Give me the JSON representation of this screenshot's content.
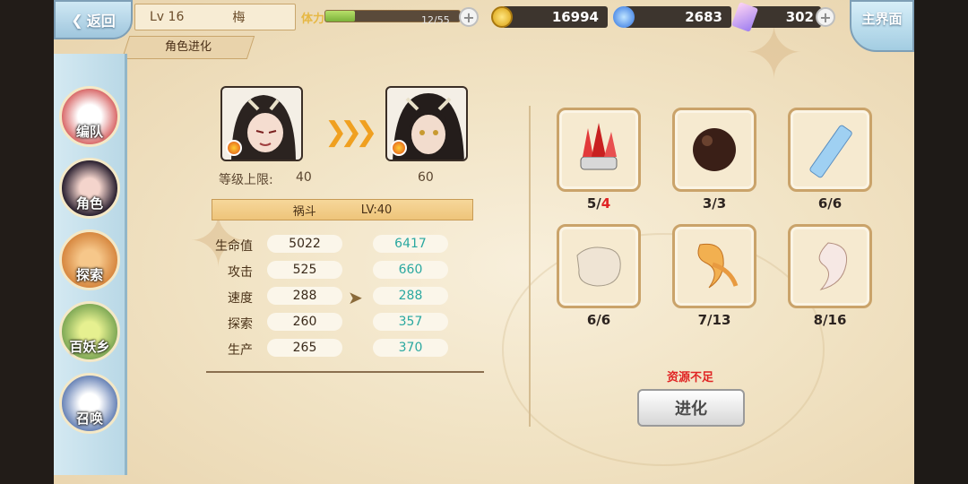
{
  "topbar": {
    "back_label": "返回",
    "level": "Lv 16",
    "name": "梅",
    "stamina_label": "体力",
    "stamina_value": "12/55",
    "stamina_fraction": 0.22,
    "gold": "16994",
    "soul": "2683",
    "crystal": "302",
    "home_label": "主界面"
  },
  "subtitle": "角色进化",
  "sidebar": {
    "items": [
      {
        "label": "编队",
        "icon": "ghost-icon"
      },
      {
        "label": "角色",
        "icon": "girl-portrait-icon"
      },
      {
        "label": "探索",
        "icon": "scroll-icon"
      },
      {
        "label": "百妖乡",
        "icon": "house-icon"
      },
      {
        "label": "召唤",
        "icon": "swirl-icon"
      }
    ]
  },
  "evolution": {
    "level_cap_label": "等级上限:",
    "level_cap_old": "40",
    "level_cap_new": "60",
    "character_name": "祸斗",
    "character_level": "LV:40",
    "stats": [
      {
        "label": "生命值",
        "old": "5022",
        "new": "6417"
      },
      {
        "label": "攻击",
        "old": "525",
        "new": "660"
      },
      {
        "label": "速度",
        "old": "288",
        "new": "288"
      },
      {
        "label": "探索",
        "old": "260",
        "new": "357"
      },
      {
        "label": "生产",
        "old": "265",
        "new": "370"
      }
    ]
  },
  "materials": [
    {
      "icon": "red-crystal-icon",
      "have": "5",
      "need": "4",
      "short": true
    },
    {
      "icon": "dark-orb-icon",
      "have": "3",
      "need": "3",
      "short": false
    },
    {
      "icon": "blue-crystal-icon",
      "have": "6",
      "need": "6",
      "short": false
    },
    {
      "icon": "fur-pelt-icon",
      "have": "6",
      "need": "6",
      "short": false
    },
    {
      "icon": "orange-feather-icon",
      "have": "7",
      "need": "13",
      "short": false
    },
    {
      "icon": "white-feather-icon",
      "have": "8",
      "need": "16",
      "short": false
    }
  ],
  "warning": "资源不足",
  "evolve_button": "进化",
  "colors": {
    "new_stat": "#2aa8a0",
    "warning": "#e02424",
    "accent_gold": "#f0a020"
  }
}
